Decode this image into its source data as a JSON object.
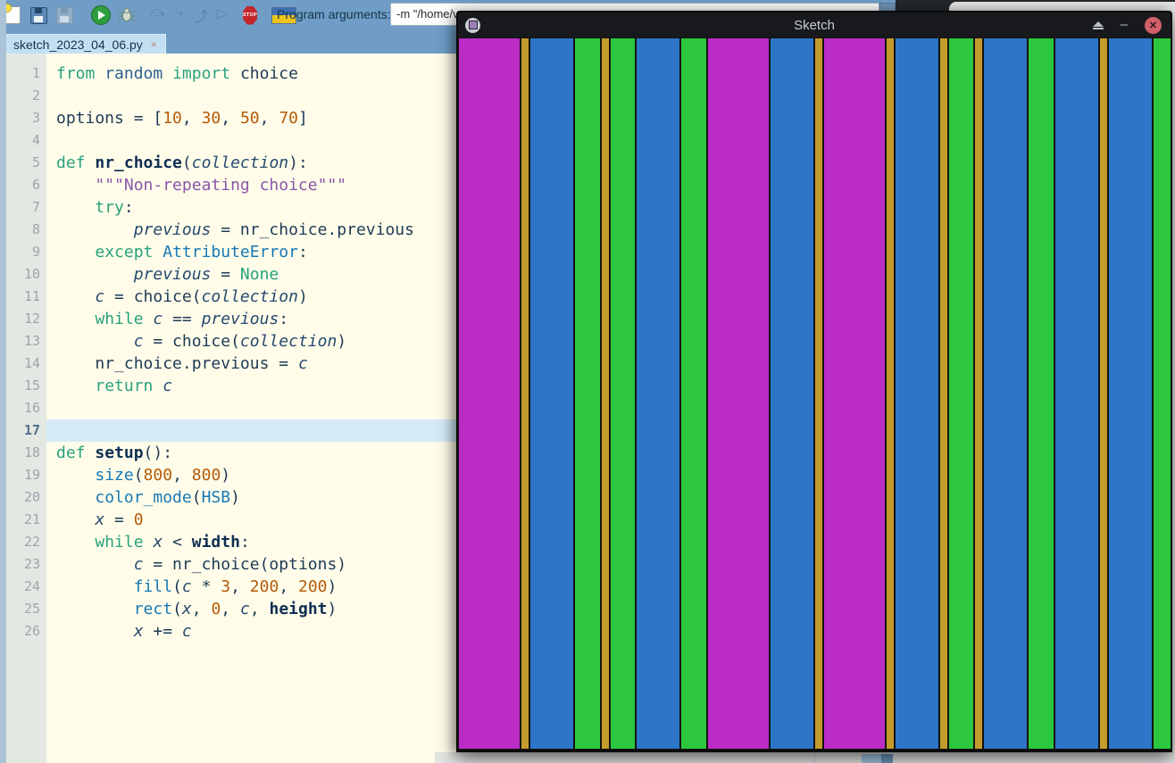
{
  "thonny": {
    "toolbar": {
      "icon_names": [
        "new-file",
        "open-file",
        "save-file",
        "run",
        "debug",
        "step-over",
        "step-into",
        "step-out",
        "resume",
        "stop",
        "ukraine-flag"
      ],
      "step_glyphs": [
        "⤼",
        "⤷",
        "⤴",
        "▷"
      ],
      "stop_text": "STOP",
      "program_arguments_label": "Program arguments:",
      "program_arguments_value": "-m \"/home/v"
    },
    "tab": {
      "label": "sketch_2023_04_06.py",
      "close_glyph": "×"
    },
    "editor": {
      "current_line": 17,
      "lines": [
        {
          "n": 1,
          "s": [
            [
              "kw",
              "from"
            ],
            [
              "pl",
              " "
            ],
            [
              "mod",
              "random"
            ],
            [
              "pl",
              " "
            ],
            [
              "kw",
              "import"
            ],
            [
              "pl",
              " "
            ],
            [
              "pl",
              "choice"
            ]
          ]
        },
        {
          "n": 2,
          "s": []
        },
        {
          "n": 3,
          "s": [
            [
              "pl",
              "options = ["
            ],
            [
              "num",
              "10"
            ],
            [
              "pl",
              ", "
            ],
            [
              "num",
              "30"
            ],
            [
              "pl",
              ", "
            ],
            [
              "num",
              "50"
            ],
            [
              "pl",
              ", "
            ],
            [
              "num",
              "70"
            ],
            [
              "pl",
              "]"
            ]
          ]
        },
        {
          "n": 4,
          "s": []
        },
        {
          "n": 5,
          "s": [
            [
              "kw",
              "def"
            ],
            [
              "pl",
              " "
            ],
            [
              "def",
              "nr_choice"
            ],
            [
              "pl",
              "("
            ],
            [
              "var",
              "collection"
            ],
            [
              "pl",
              "):"
            ]
          ]
        },
        {
          "n": 6,
          "s": [
            [
              "pl",
              "    "
            ],
            [
              "str",
              "\"\"\"Non-repeating choice\"\"\""
            ]
          ]
        },
        {
          "n": 7,
          "s": [
            [
              "pl",
              "    "
            ],
            [
              "kw",
              "try"
            ],
            [
              "pl",
              ":"
            ]
          ]
        },
        {
          "n": 8,
          "s": [
            [
              "pl",
              "        "
            ],
            [
              "var",
              "previous"
            ],
            [
              "pl",
              " = nr_choice.previous"
            ]
          ]
        },
        {
          "n": 9,
          "s": [
            [
              "pl",
              "    "
            ],
            [
              "kw",
              "except"
            ],
            [
              "pl",
              " "
            ],
            [
              "fn",
              "AttributeError"
            ],
            [
              "pl",
              ":"
            ]
          ]
        },
        {
          "n": 10,
          "s": [
            [
              "pl",
              "        "
            ],
            [
              "var",
              "previous"
            ],
            [
              "pl",
              " = "
            ],
            [
              "kw",
              "None"
            ]
          ]
        },
        {
          "n": 11,
          "s": [
            [
              "pl",
              "    "
            ],
            [
              "var",
              "c"
            ],
            [
              "pl",
              " = choice("
            ],
            [
              "var",
              "collection"
            ],
            [
              "pl",
              ")"
            ]
          ]
        },
        {
          "n": 12,
          "s": [
            [
              "pl",
              "    "
            ],
            [
              "kw",
              "while"
            ],
            [
              "pl",
              " "
            ],
            [
              "var",
              "c"
            ],
            [
              "pl",
              " == "
            ],
            [
              "var",
              "previous"
            ],
            [
              "pl",
              ":"
            ]
          ]
        },
        {
          "n": 13,
          "s": [
            [
              "pl",
              "        "
            ],
            [
              "var",
              "c"
            ],
            [
              "pl",
              " = choice("
            ],
            [
              "var",
              "collection"
            ],
            [
              "pl",
              ")"
            ]
          ]
        },
        {
          "n": 14,
          "s": [
            [
              "pl",
              "    nr_choice.previous = "
            ],
            [
              "var",
              "c"
            ]
          ]
        },
        {
          "n": 15,
          "s": [
            [
              "pl",
              "    "
            ],
            [
              "kw",
              "return"
            ],
            [
              "pl",
              " "
            ],
            [
              "var",
              "c"
            ]
          ]
        },
        {
          "n": 16,
          "s": []
        },
        {
          "n": 17,
          "s": []
        },
        {
          "n": 18,
          "s": [
            [
              "kw",
              "def"
            ],
            [
              "pl",
              " "
            ],
            [
              "def",
              "setup"
            ],
            [
              "pl",
              "():"
            ]
          ]
        },
        {
          "n": 19,
          "s": [
            [
              "pl",
              "    "
            ],
            [
              "fn",
              "size"
            ],
            [
              "pl",
              "("
            ],
            [
              "num",
              "800"
            ],
            [
              "pl",
              ", "
            ],
            [
              "num",
              "800"
            ],
            [
              "pl",
              ")"
            ]
          ]
        },
        {
          "n": 20,
          "s": [
            [
              "pl",
              "    "
            ],
            [
              "fn",
              "color_mode"
            ],
            [
              "pl",
              "("
            ],
            [
              "fn",
              "HSB"
            ],
            [
              "pl",
              ")"
            ]
          ]
        },
        {
          "n": 21,
          "s": [
            [
              "pl",
              "    "
            ],
            [
              "var",
              "x"
            ],
            [
              "pl",
              " = "
            ],
            [
              "num",
              "0"
            ]
          ]
        },
        {
          "n": 22,
          "s": [
            [
              "pl",
              "    "
            ],
            [
              "kw",
              "while"
            ],
            [
              "pl",
              " "
            ],
            [
              "var",
              "x"
            ],
            [
              "pl",
              " < "
            ],
            [
              "def",
              "width"
            ],
            [
              "pl",
              ":"
            ]
          ]
        },
        {
          "n": 23,
          "s": [
            [
              "pl",
              "        "
            ],
            [
              "var",
              "c"
            ],
            [
              "pl",
              " = nr_choice(options)"
            ]
          ]
        },
        {
          "n": 24,
          "s": [
            [
              "pl",
              "        "
            ],
            [
              "fn",
              "fill"
            ],
            [
              "pl",
              "("
            ],
            [
              "var",
              "c"
            ],
            [
              "pl",
              " * "
            ],
            [
              "num",
              "3"
            ],
            [
              "pl",
              ", "
            ],
            [
              "num",
              "200"
            ],
            [
              "pl",
              ", "
            ],
            [
              "num",
              "200"
            ],
            [
              "pl",
              ")"
            ]
          ]
        },
        {
          "n": 25,
          "s": [
            [
              "pl",
              "        "
            ],
            [
              "fn",
              "rect"
            ],
            [
              "pl",
              "("
            ],
            [
              "var",
              "x"
            ],
            [
              "pl",
              ", "
            ],
            [
              "num",
              "0"
            ],
            [
              "pl",
              ", "
            ],
            [
              "var",
              "c"
            ],
            [
              "pl",
              ", "
            ],
            [
              "def",
              "height"
            ],
            [
              "pl",
              ")"
            ]
          ]
        },
        {
          "n": 26,
          "s": [
            [
              "pl",
              "        "
            ],
            [
              "var",
              "x"
            ],
            [
              "pl",
              " += "
            ],
            [
              "var",
              "c"
            ]
          ]
        }
      ]
    }
  },
  "sketch_window": {
    "title": "Sketch",
    "buttons": {
      "minimize_glyph": "–",
      "close_glyph": "✕"
    },
    "canvas": {
      "width_units": 800,
      "palette": {
        "magenta": "#bb2cc7",
        "yellow": "#c49c2d",
        "green": "#2cc73e",
        "blue": "#2c75c7"
      },
      "stripes": [
        {
          "color": "magenta",
          "w": 70
        },
        {
          "color": "yellow",
          "w": 10
        },
        {
          "color": "blue",
          "w": 50
        },
        {
          "color": "green",
          "w": 30
        },
        {
          "color": "yellow",
          "w": 10
        },
        {
          "color": "green",
          "w": 30
        },
        {
          "color": "blue",
          "w": 50
        },
        {
          "color": "green",
          "w": 30
        },
        {
          "color": "magenta",
          "w": 70
        },
        {
          "color": "blue",
          "w": 50
        },
        {
          "color": "yellow",
          "w": 10
        },
        {
          "color": "magenta",
          "w": 70
        },
        {
          "color": "yellow",
          "w": 10
        },
        {
          "color": "blue",
          "w": 50
        },
        {
          "color": "yellow",
          "w": 10
        },
        {
          "color": "green",
          "w": 30
        },
        {
          "color": "yellow",
          "w": 10
        },
        {
          "color": "blue",
          "w": 50
        },
        {
          "color": "green",
          "w": 30
        },
        {
          "color": "blue",
          "w": 50
        },
        {
          "color": "yellow",
          "w": 10
        },
        {
          "color": "blue",
          "w": 50
        },
        {
          "color": "green",
          "w": 30
        }
      ]
    }
  },
  "colors": {
    "toolbar_blue": "#6f9dc6",
    "editor_bg": "#fffdea",
    "gutter_bg": "#e4e8e2",
    "current_line_highlight": "#d4ebf7",
    "titlebar_dark": "#17191c",
    "close_red": "#d2606a"
  }
}
